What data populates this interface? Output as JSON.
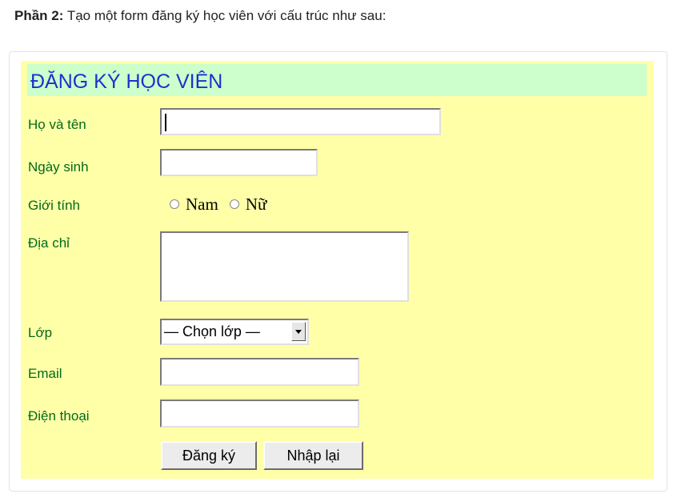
{
  "intro": {
    "bold": "Phần 2:",
    "text": " Tạo một form đăng ký học viên với cấu trúc như sau:"
  },
  "form": {
    "title": "ĐĂNG KÝ HỌC VIÊN",
    "labels": {
      "name": "Họ và tên",
      "dob": "Ngày sinh",
      "gender": "Giới tính",
      "address": "Địa chỉ",
      "class": "Lớp",
      "email": "Email",
      "phone": "Điện thoại"
    },
    "gender_options": [
      "Nam",
      "Nữ"
    ],
    "class_select": {
      "selected": "— Chọn lớp —"
    },
    "buttons": {
      "submit": "Đăng ký",
      "reset": "Nhập lại"
    }
  },
  "colors": {
    "form_bg": "#ffffa8",
    "title_bg": "#ccffcc",
    "title_text": "#1a33cc",
    "label_text": "#006b1a"
  }
}
